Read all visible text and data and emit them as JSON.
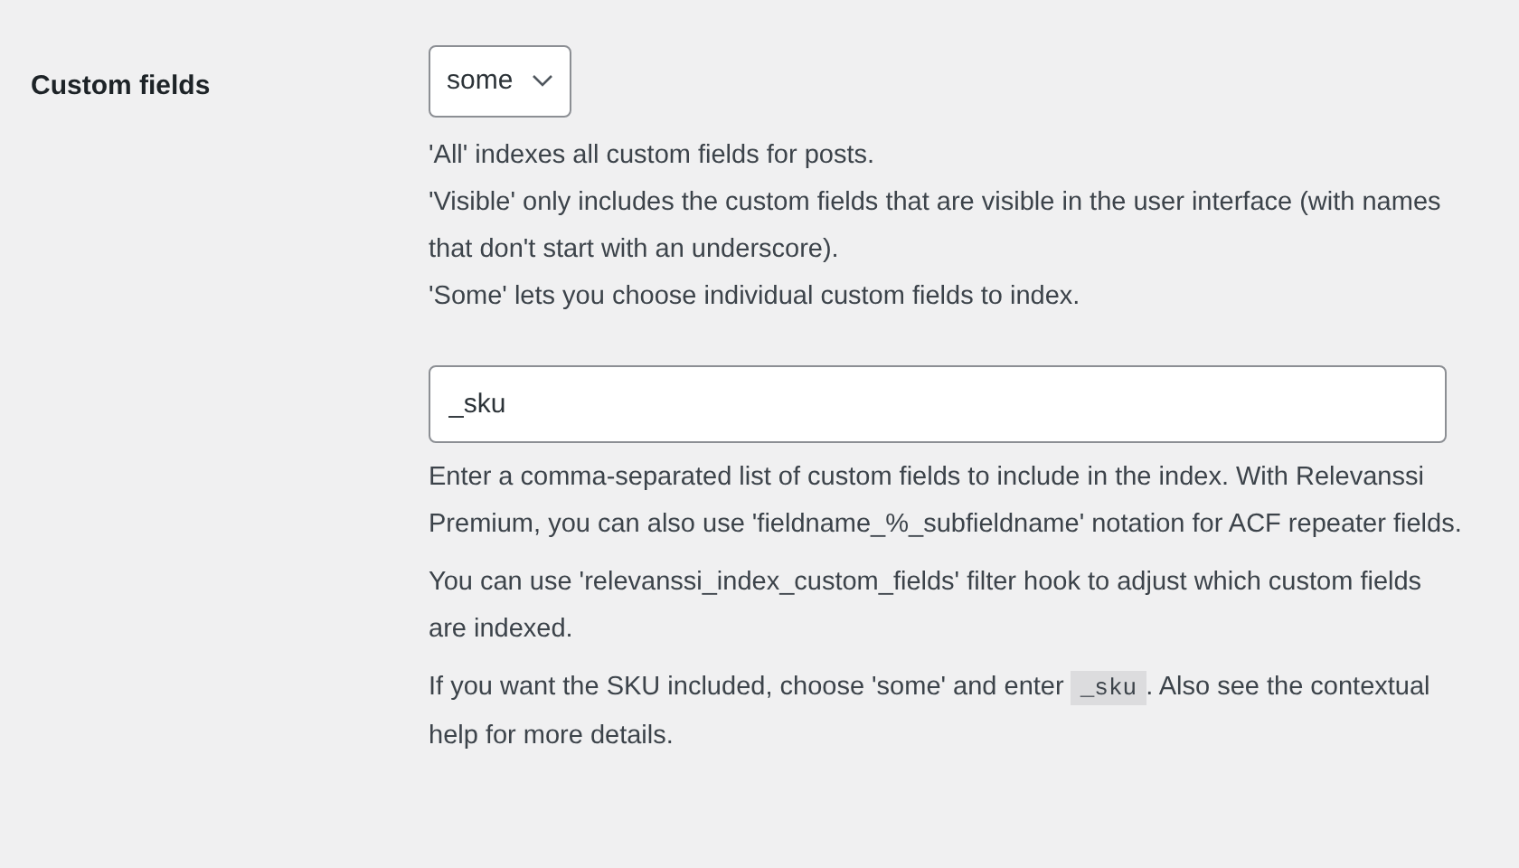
{
  "field": {
    "label": "Custom fields"
  },
  "select": {
    "value": "some"
  },
  "descriptions": [
    "'All' indexes all custom fields for posts.",
    "'Visible' only includes the custom fields that are visible in the user interface (with names that don't start with an underscore).",
    "'Some' lets you choose individual custom fields to index."
  ],
  "input": {
    "value": "_sku"
  },
  "notes": [
    {
      "text": "Enter a comma-separated list of custom fields to include in the index. With Relevanssi Premium, you can also use 'fieldname_%_subfieldname' notation for ACF repeater fields."
    },
    {
      "text": "You can use 'relevanssi_index_custom_fields' filter hook to adjust which custom fields are indexed."
    },
    {
      "text": "If you want the SKU included, choose 'some' and enter",
      "code": "_sku",
      "after": ". Also see the contextual help for more details."
    }
  ]
}
